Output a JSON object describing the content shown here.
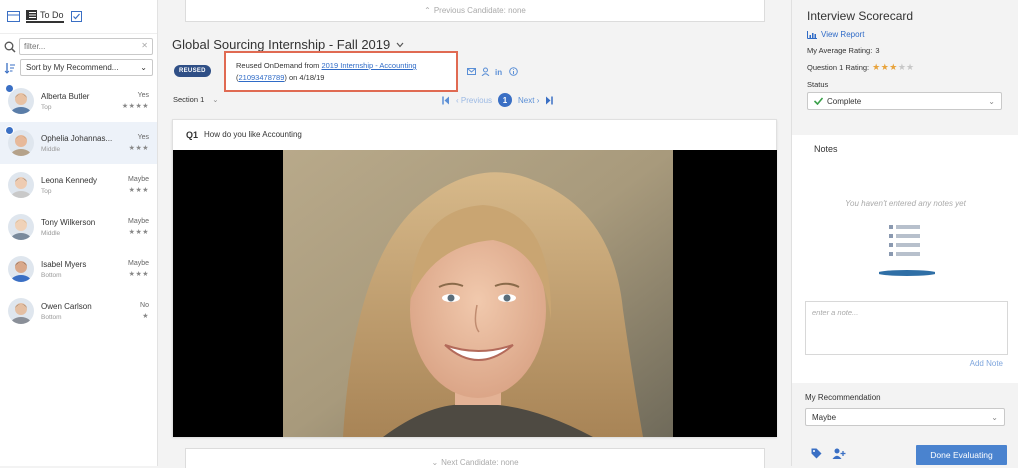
{
  "sidebar": {
    "todo_label": "To Do",
    "filter_placeholder": "filter...",
    "sort_label": "Sort by My Recommend...",
    "candidates": [
      {
        "name": "Alberta Butler",
        "stage": "Top",
        "rec": "Yes",
        "stars": "★★★★",
        "flag": true
      },
      {
        "name": "Ophelia Johannas...",
        "stage": "Middle",
        "rec": "Yes",
        "stars": "★★★",
        "flag": true
      },
      {
        "name": "Leona Kennedy",
        "stage": "Top",
        "rec": "Maybe",
        "stars": "★★★",
        "flag": false
      },
      {
        "name": "Tony Wilkerson",
        "stage": "Middle",
        "rec": "Maybe",
        "stars": "★★★",
        "flag": false
      },
      {
        "name": "Isabel Myers",
        "stage": "Bottom",
        "rec": "Maybe",
        "stars": "★★★",
        "flag": false
      },
      {
        "name": "Owen Carlson",
        "stage": "Bottom",
        "rec": "No",
        "stars": "★",
        "flag": false
      }
    ]
  },
  "center": {
    "prev_candidate": "Previous Candidate: none",
    "next_candidate": "Next Candidate: none",
    "job_title": "Global Sourcing Internship - Fall 2019",
    "reused_badge": "REUSED",
    "tooltip": {
      "prefix": "Reused OnDemand from ",
      "link1": "2019 Internship - Accounting",
      "mid": " (",
      "link2": "21093478789",
      "suffix": ") on 4/18/19"
    },
    "section_label": "Section 1",
    "pager": {
      "previous": "Previous",
      "page": "1",
      "next": "Next"
    },
    "question": {
      "number": "Q1",
      "text": "How do you like Accounting"
    }
  },
  "scorecard": {
    "title": "Interview Scorecard",
    "view_report": "View Report",
    "avg_rating_label": "My Average Rating:",
    "avg_rating_value": "3",
    "q1_rating_label": "Question 1 Rating:",
    "q1_rating_value": 3,
    "status_label": "Status",
    "status_value": "Complete",
    "notes_title": "Notes",
    "notes_empty": "You haven't entered any notes yet",
    "note_placeholder": "enter a note...",
    "add_note": "Add Note",
    "recommendation_label": "My Recommendation",
    "recommendation_value": "Maybe",
    "done_button": "Done Evaluating"
  },
  "colors": {
    "accent": "#3a6fc4",
    "tooltip_border": "#e06a52",
    "star": "#e8a33b",
    "button": "#4a83cf"
  }
}
